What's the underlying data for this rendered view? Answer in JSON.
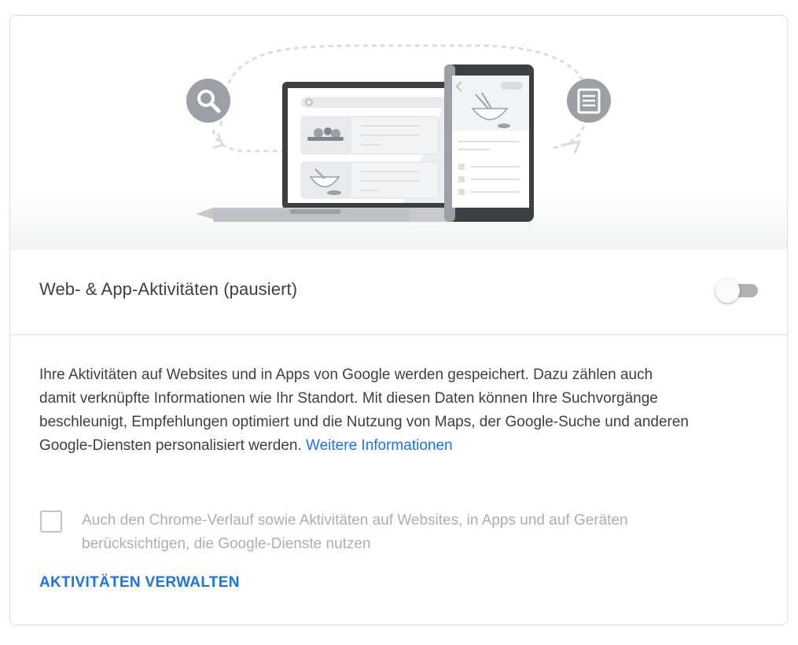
{
  "illustration": {
    "left_icon": "search-icon",
    "right_icon": "document-icon",
    "device_left": "laptop",
    "device_right": "phone"
  },
  "setting": {
    "title": "Web- & App-Aktivitäten (pausiert)",
    "enabled": false
  },
  "description": {
    "text": "Ihre Aktivitäten auf Websites und in Apps von Google werden gespeichert. Dazu zählen auch damit verknüpfte Informationen wie Ihr Standort. Mit diesen Daten können Ihre Suchvorgänge beschleunigt, Empfehlungen optimiert und die Nutzung von Maps, der Google-Suche und anderen Google-Diensten personalisiert werden. ",
    "link_label": "Weitere Informationen"
  },
  "chrome_history": {
    "label": "Auch den Chrome-Verlauf sowie Aktivitäten auf Websites, in Apps und auf Geräten berücksichtigen, die Google-Dienste nutzen",
    "checked": false,
    "disabled": true
  },
  "actions": {
    "manage_label": "AKTIVITÄTEN VERWALTEN"
  },
  "colors": {
    "link": "#1a73e8",
    "text": "#3c4043",
    "disabled_text": "#aeaeae",
    "switch_track": "#b1b1b1",
    "border": "#dadce0"
  }
}
